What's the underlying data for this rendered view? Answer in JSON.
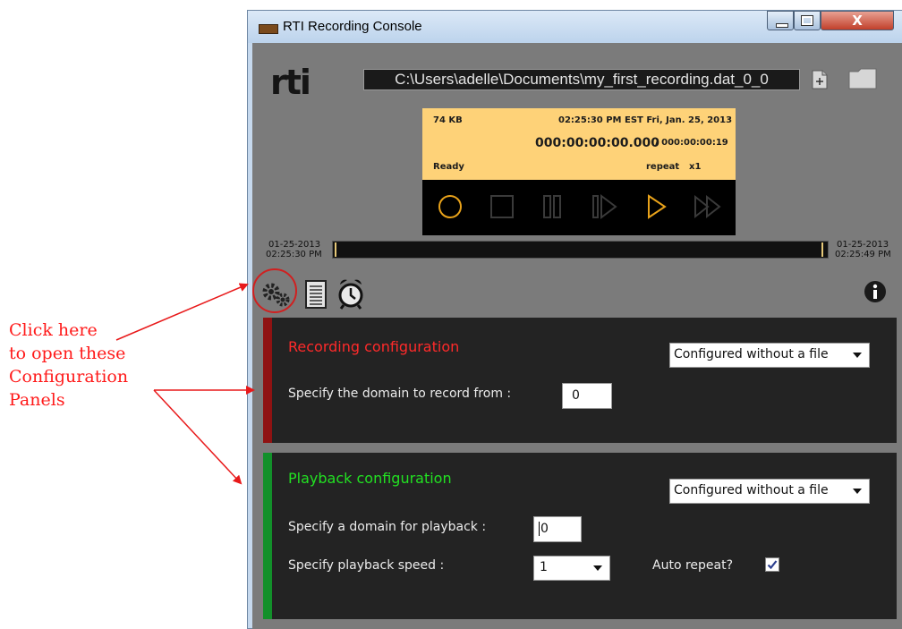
{
  "window": {
    "title": "RTI Recording Console",
    "controls": {
      "minimize": "–",
      "maximize": "□",
      "close": "X"
    }
  },
  "header": {
    "logo": "rti",
    "file_path": "C:\\Users\\adelle\\Documents\\my_first_recording.dat_0_0",
    "icons": [
      "new-file-icon",
      "folder-icon"
    ]
  },
  "display": {
    "size": "74 KB",
    "timestamp": "02:25:30 PM EST  Fri, Jan. 25, 2013",
    "elapsed": "000:00:00:00.000",
    "total": "/ 000:00:00:19",
    "status": "Ready",
    "repeat": "repeat",
    "speed": "x1",
    "background": "#fed278"
  },
  "transport": {
    "buttons": [
      "record-icon",
      "stop-icon",
      "pause-icon",
      "step-icon",
      "play-icon",
      "fast-forward-icon"
    ],
    "accent": "#e8a21a",
    "inactive": "#3a3a3a"
  },
  "timeline": {
    "start_date": "01-25-2013",
    "start_time": "02:25:30 PM",
    "end_date": "01-25-2013",
    "end_time": "02:25:49 PM"
  },
  "toolbar": {
    "icons": [
      "gear-icon",
      "notes-icon",
      "alarm-clock-icon",
      "info-icon"
    ]
  },
  "recording": {
    "title": "Recording configuration",
    "title_color": "#ff2a2a",
    "mode": "Configured without a file",
    "domain_label": "Specify the domain to record from :",
    "domain_value": "0",
    "stripe_color": "#8f1212"
  },
  "playback": {
    "title": "Playback configuration",
    "title_color": "#22e022",
    "mode": "Configured without a file",
    "domain_label": "Specify a domain for playback :",
    "domain_value": "0",
    "speed_label": "Specify playback speed :",
    "speed_value": "1",
    "auto_repeat_label": "Auto repeat?",
    "auto_repeat_checked": true,
    "stripe_color": "#12902a"
  },
  "annotation": {
    "lines": [
      "Click here",
      "to open these",
      "Configuration",
      "Panels"
    ],
    "color": "#ff1a1a"
  }
}
